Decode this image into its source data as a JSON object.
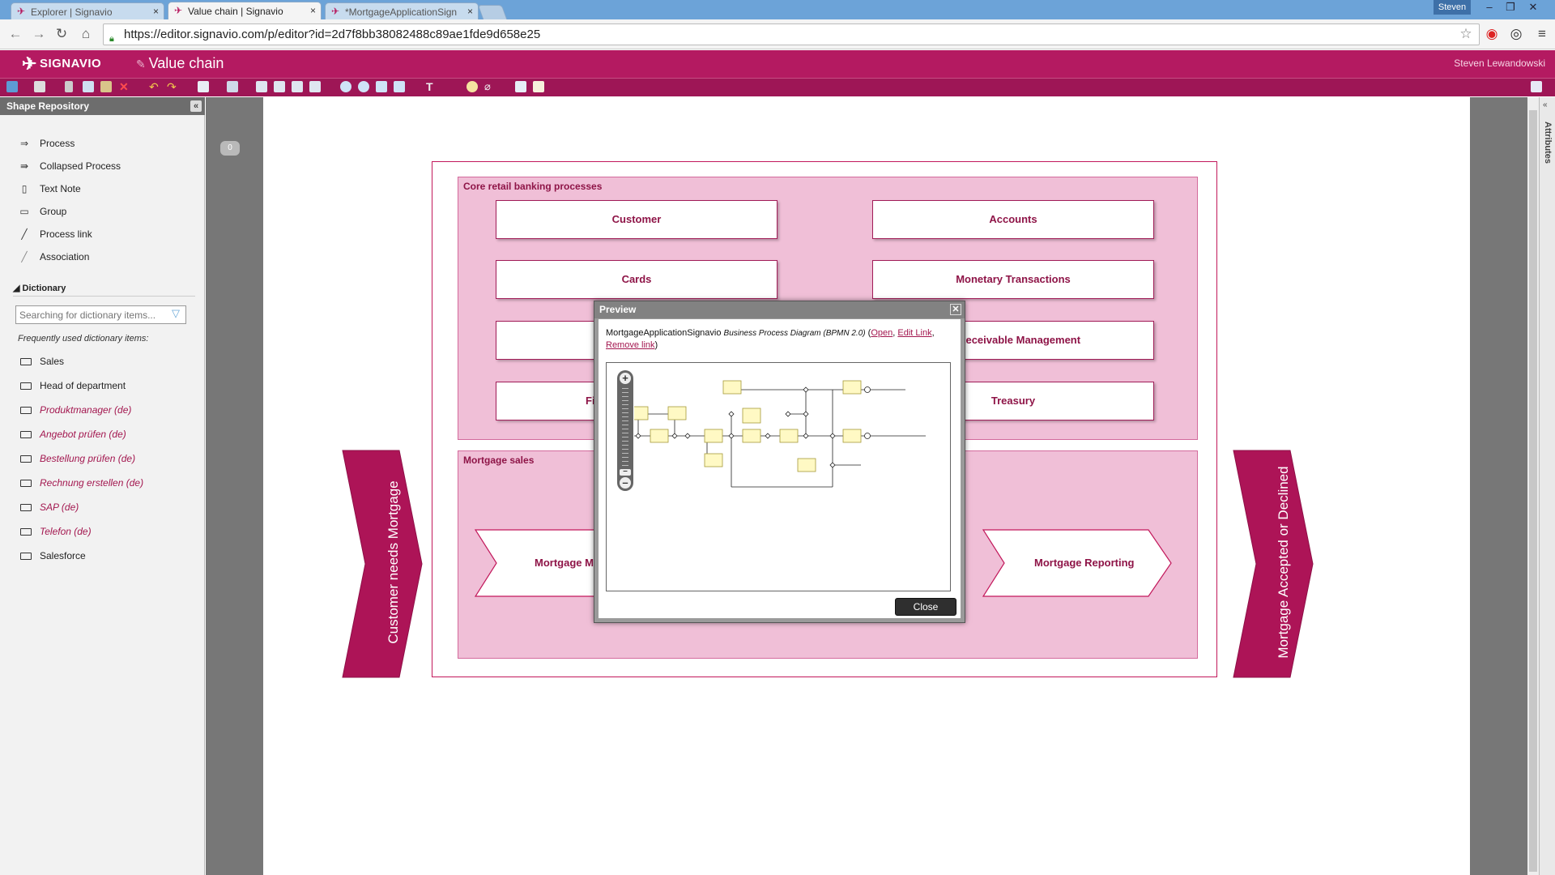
{
  "browser": {
    "tabs": [
      {
        "title": "Explorer | Signavio"
      },
      {
        "title": "Value chain | Signavio"
      },
      {
        "title": "*MortgageApplicationSign"
      }
    ],
    "user_chip": "Steven",
    "url": "https://editor.signavio.com/p/editor?id=2d7f8bb38082488c89ae1fde9d658e25"
  },
  "app": {
    "brand": "SIGNAVIO",
    "document_title": "Value chain",
    "user_name": "Steven Lewandowski",
    "brand_color": "#b41a61"
  },
  "sidebar": {
    "title": "Shape Repository",
    "shapes": [
      {
        "label": "Process",
        "icon": "process-chevron-icon"
      },
      {
        "label": "Collapsed Process",
        "icon": "collapsed-process-icon"
      },
      {
        "label": "Text Note",
        "icon": "text-note-icon"
      },
      {
        "label": "Group",
        "icon": "group-icon"
      },
      {
        "label": "Process link",
        "icon": "process-link-icon"
      },
      {
        "label": "Association",
        "icon": "association-icon"
      }
    ],
    "dictionary_title": "Dictionary",
    "search_placeholder": "Searching for dictionary items...",
    "frequent_label": "Frequently used dictionary items:",
    "dictionary_items": [
      {
        "label": "Sales",
        "style": "plain"
      },
      {
        "label": "Head of department",
        "style": "plain"
      },
      {
        "label": "Produktmanager (de)",
        "style": "de"
      },
      {
        "label": "Angebot prüfen (de)",
        "style": "de"
      },
      {
        "label": "Bestellung prüfen (de)",
        "style": "de"
      },
      {
        "label": "Rechnung erstellen (de)",
        "style": "de"
      },
      {
        "label": "SAP (de)",
        "style": "de"
      },
      {
        "label": "Telefon (de)",
        "style": "de"
      },
      {
        "label": "Salesforce",
        "style": "plain"
      }
    ]
  },
  "canvas": {
    "comment_count": "0",
    "attributes_label": "Attributes"
  },
  "diagram": {
    "core_pool_title": "Core retail banking processes",
    "core_processes": [
      "Customer",
      "Accounts",
      "Cards",
      "Monetary Transactions",
      "",
      "ts Receivable Management",
      "Fi",
      "Treasury"
    ],
    "sales_pool_title": "Mortgage sales",
    "sales_processes": [
      "Mortgage Ma",
      "Mortgage Reporting"
    ],
    "start_label": "Customer needs Mortgage",
    "end_label": "Mortgage Accepted or Declined"
  },
  "preview": {
    "title": "Preview",
    "diagram_name": "MortgageApplicationSignavio",
    "diagram_type": "Business Process Diagram (BPMN 2.0)",
    "open_link": "Open",
    "edit_link": "Edit Link",
    "remove_link": "Remove link",
    "close_button": "Close"
  }
}
